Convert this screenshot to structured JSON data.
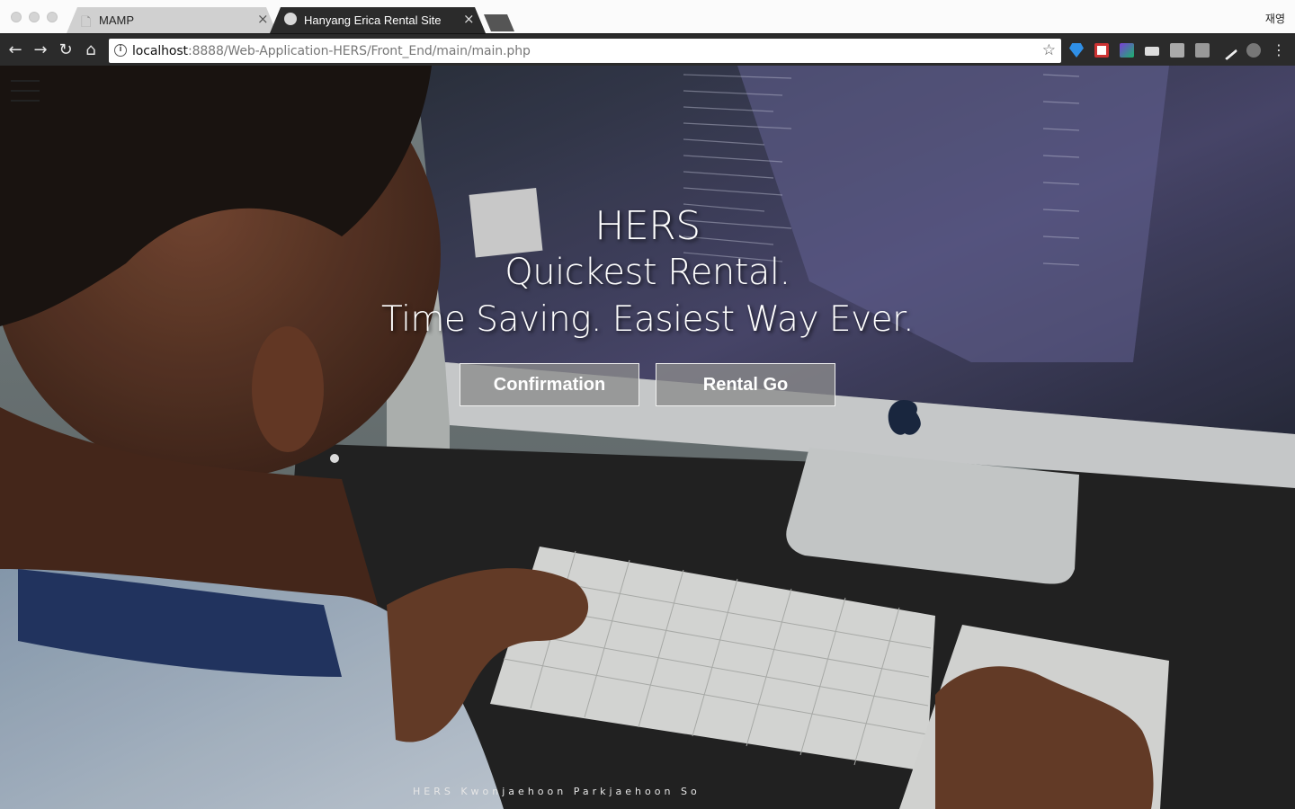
{
  "browser": {
    "tabs": [
      {
        "title": "MAMP",
        "active": false
      },
      {
        "title": "Hanyang Erica Rental Site",
        "active": true
      }
    ],
    "user_name": "재영",
    "url": {
      "host": "localhost",
      "path": ":8888/Web-Application-HERS/Front_End/main/main.php"
    },
    "colors": {
      "tabbar": "#fbfbfb",
      "toolbar": "#2b2b2b",
      "active_tab": "#2b2b2b"
    }
  },
  "page": {
    "hero": {
      "line1": "HERS",
      "line2": "Quickest Rental.",
      "line3": "Time Saving. Easiest Way Ever."
    },
    "buttons": {
      "confirmation": "Confirmation",
      "rental_go": "Rental Go"
    },
    "footer": "HERS Kwonjaehoon Parkjaehoon So"
  }
}
